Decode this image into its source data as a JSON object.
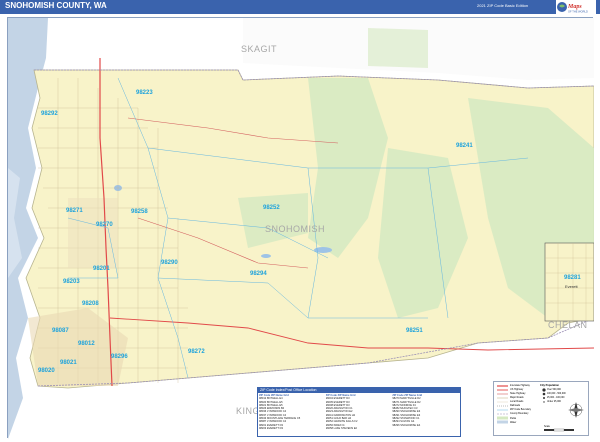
{
  "header": {
    "title": "SNOHOMISH COUNTY, WA",
    "edition": "2021 ZIP Code Basic Edition",
    "logo_line1": "Maps",
    "logo_line2": "OF THE WORLD"
  },
  "map": {
    "county_labels": [
      "SKAGIT",
      "SNOHOMISH",
      "CHELAN",
      "KING"
    ],
    "zip_labels": [
      "98223",
      "98292",
      "98241",
      "98271",
      "98258",
      "98252",
      "98270",
      "98201",
      "98290",
      "98294",
      "98203",
      "98208",
      "98251",
      "98272",
      "98012",
      "98296",
      "98021",
      "98020",
      "98087",
      "98281"
    ],
    "inset": {
      "zip": "98281",
      "city": "Everett"
    },
    "colors": {
      "county_fill": "#f8f3c9",
      "water": "#c3d4e6",
      "zip_text": "#1fa3dc",
      "parks": "#d5e9c2",
      "header": "#3a63ad"
    }
  },
  "legend": {
    "heading": "ZIP Code Index/Post Office Location",
    "columns": [
      {
        "headers": [
          "ZIP Code",
          "ZIP Name",
          "Grid"
        ],
        "rows": [
          [
            "98012",
            "BOTHELL",
            "E4"
          ],
          [
            "98020",
            "BOTHELL",
            "E5"
          ],
          [
            "98021",
            "BOTHELL",
            "E5"
          ],
          [
            "98026",
            "EDMONDS",
            "B4"
          ],
          [
            "98036",
            "LYNNWOOD",
            "C4"
          ],
          [
            "98037",
            "LYNNWOOD",
            "C4"
          ],
          [
            "98043",
            "MOUNTLAKE TERRACE",
            "C5"
          ],
          [
            "98087",
            "LYNNWOOD",
            "C4"
          ],
          [
            "98201",
            "EVERETT",
            "D3"
          ],
          [
            "98203",
            "EVERETT",
            "D3"
          ]
        ]
      },
      {
        "headers": [
          "ZIP Code",
          "ZIP Name",
          "Grid"
        ],
        "rows": [
          [
            "98204",
            "EVERETT",
            "D3"
          ],
          [
            "98205",
            "EVERETT",
            "D3"
          ],
          [
            "98208",
            "EVERETT",
            "D3"
          ],
          [
            "98220",
            "ARLINGTON",
            "C1"
          ],
          [
            "98223",
            "ARLINGTON",
            "E2"
          ],
          [
            "98241",
            "DARRINGTON",
            "H2"
          ],
          [
            "98251",
            "GOLD BAR",
            "H4"
          ],
          [
            "98252",
            "GRANITE FALLS",
            "F2"
          ],
          [
            "98256",
            "INDEX",
            "I4"
          ],
          [
            "98258",
            "LAKE STEVENS",
            "E2"
          ]
        ]
      },
      {
        "headers": [
          "ZIP Code",
          "ZIP Name",
          "Grid"
        ],
        "rows": [
          [
            "98270",
            "MARYSVILLE",
            "D2"
          ],
          [
            "98271",
            "MARYSVILLE",
            "D2"
          ],
          [
            "98272",
            "MONROE",
            "F4"
          ],
          [
            "98282",
            "MUKILTEO",
            "C3"
          ],
          [
            "98290",
            "SNOHOMISH",
            "E3"
          ],
          [
            "98291",
            "SNOHOMISH",
            "E3"
          ],
          [
            "98292",
            "STANWOOD",
            "C1"
          ],
          [
            "98294",
            "SULTAN",
            "G4"
          ],
          [
            "98296",
            "SNOHOMISH",
            "E4"
          ]
        ]
      }
    ]
  },
  "map_key": {
    "rows": [
      "Interstate Highway",
      "US Highway",
      "State Highway",
      "Major Roads",
      "Local Roads",
      "Railroads",
      "ZIP Code Boundary",
      "County Boundary",
      "Parks",
      "Water"
    ],
    "city_size_title": "City Population",
    "city_sizes": [
      "Over 500,000",
      "100,000 - 500,000",
      "25,000 - 100,000",
      "Under 25,000"
    ],
    "scale_label": "Scale"
  }
}
